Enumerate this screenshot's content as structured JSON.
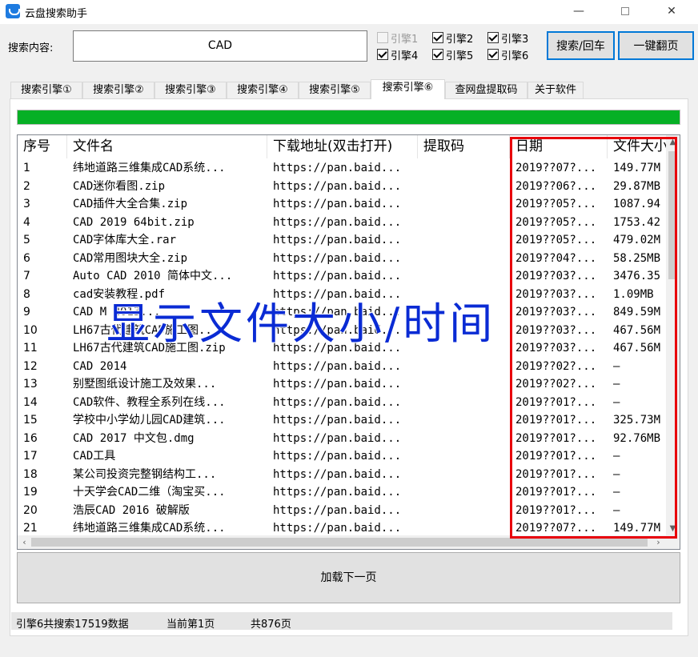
{
  "window": {
    "title": "云盘搜索助手",
    "min": "—",
    "close": "✕"
  },
  "search": {
    "label": "搜索内容:",
    "value": "CAD"
  },
  "engines": [
    {
      "label": "引擎1",
      "checked": false,
      "disabled": true
    },
    {
      "label": "引擎2",
      "checked": true,
      "disabled": false
    },
    {
      "label": "引擎3",
      "checked": true,
      "disabled": false
    },
    {
      "label": "引擎4",
      "checked": true,
      "disabled": false
    },
    {
      "label": "引擎5",
      "checked": true,
      "disabled": false
    },
    {
      "label": "引擎6",
      "checked": true,
      "disabled": false
    }
  ],
  "buttons": {
    "search": "搜索/回车",
    "flip": "一键翻页",
    "load_next": "加载下一页"
  },
  "tabs": [
    {
      "label": "搜索引擎①",
      "active": false
    },
    {
      "label": "搜索引擎②",
      "active": false
    },
    {
      "label": "搜索引擎③",
      "active": false
    },
    {
      "label": "搜索引擎④",
      "active": false
    },
    {
      "label": "搜索引擎⑤",
      "active": false
    },
    {
      "label": "搜索引擎⑥",
      "active": true
    },
    {
      "label": "查网盘提取码",
      "active": false
    },
    {
      "label": "关于软件",
      "active": false
    }
  ],
  "progress": {
    "value": 1.0
  },
  "table": {
    "headers": [
      "序号",
      "文件名",
      "下载地址(双击打开)",
      "提取码",
      "日期",
      "文件大小"
    ],
    "rows": [
      [
        "1",
        "纬地道路三维集成CAD系统...",
        "https://pan.baid...",
        "",
        "2019??07?...",
        "149.77M"
      ],
      [
        "2",
        "CAD迷你看图.zip",
        "https://pan.baid...",
        "",
        "2019??06?...",
        "29.87MB"
      ],
      [
        "3",
        "CAD插件大全合集.zip",
        "https://pan.baid...",
        "",
        "2019??05?...",
        "1087.94"
      ],
      [
        "4",
        "CAD 2019 64bit.zip",
        "https://pan.baid...",
        "",
        "2019??05?...",
        "1753.42"
      ],
      [
        "5",
        "CAD字体库大全.rar",
        "https://pan.baid...",
        "",
        "2019??05?...",
        "479.02M"
      ],
      [
        "6",
        "CAD常用图块大全.zip",
        "https://pan.baid...",
        "",
        "2019??04?...",
        "58.25MB"
      ],
      [
        "7",
        "Auto CAD 2010 简体中文...",
        "https://pan.baid...",
        "",
        "2019??03?...",
        "3476.35"
      ],
      [
        "8",
        "cad安装教程.pdf",
        "https://pan.baid...",
        "",
        "2019??03?...",
        "1.09MB"
      ],
      [
        "9",
        "CAD M 2013...",
        "https://pan.baid...",
        "",
        "2019??03?...",
        "849.59M"
      ],
      [
        "10",
        "LH67古代建筑CAD施工图...",
        "https://pan.baid...",
        "",
        "2019??03?...",
        "467.56M"
      ],
      [
        "11",
        "LH67古代建筑CAD施工图.zip",
        "https://pan.baid...",
        "",
        "2019??03?...",
        "467.56M"
      ],
      [
        "12",
        "CAD   2014",
        "https://pan.baid...",
        "",
        "2019??02?...",
        "—"
      ],
      [
        "13",
        "别墅图纸设计施工及效果...",
        "https://pan.baid...",
        "",
        "2019??02?...",
        "—"
      ],
      [
        "14",
        "CAD软件、教程全系列在线...",
        "https://pan.baid...",
        "",
        "2019??01?...",
        "—"
      ],
      [
        "15",
        "学校中小学幼儿园CAD建筑...",
        "https://pan.baid...",
        "",
        "2019??01?...",
        "325.73M"
      ],
      [
        "16",
        "CAD 2017 中文包.dmg",
        "https://pan.baid...",
        "",
        "2019??01?...",
        "92.76MB"
      ],
      [
        "17",
        "CAD工具",
        "https://pan.baid...",
        "",
        "2019??01?...",
        "—"
      ],
      [
        "18",
        "某公司投资完整钢结构工...",
        "https://pan.baid...",
        "",
        "2019??01?...",
        "—"
      ],
      [
        "19",
        "十天学会CAD二维（淘宝买...",
        "https://pan.baid...",
        "",
        "2019??01?...",
        "—"
      ],
      [
        "20",
        "浩辰CAD 2016 破解版",
        "https://pan.baid...",
        "",
        "2019??01?...",
        "—"
      ],
      [
        "21",
        "纬地道路三维集成CAD系统...",
        "https://pan.baid...",
        "",
        "2019??07?...",
        "149.77M"
      ]
    ]
  },
  "annotation": {
    "text": "显示文件大小/时间",
    "color": "#e8000b"
  },
  "status": {
    "summary": "引擎6共搜索17519数据",
    "current_page": "当前第1页",
    "total_pages": "共876页"
  },
  "colors": {
    "accent": "#0078d7",
    "progress": "#06b025",
    "annotation_text": "#0a2bd4"
  }
}
